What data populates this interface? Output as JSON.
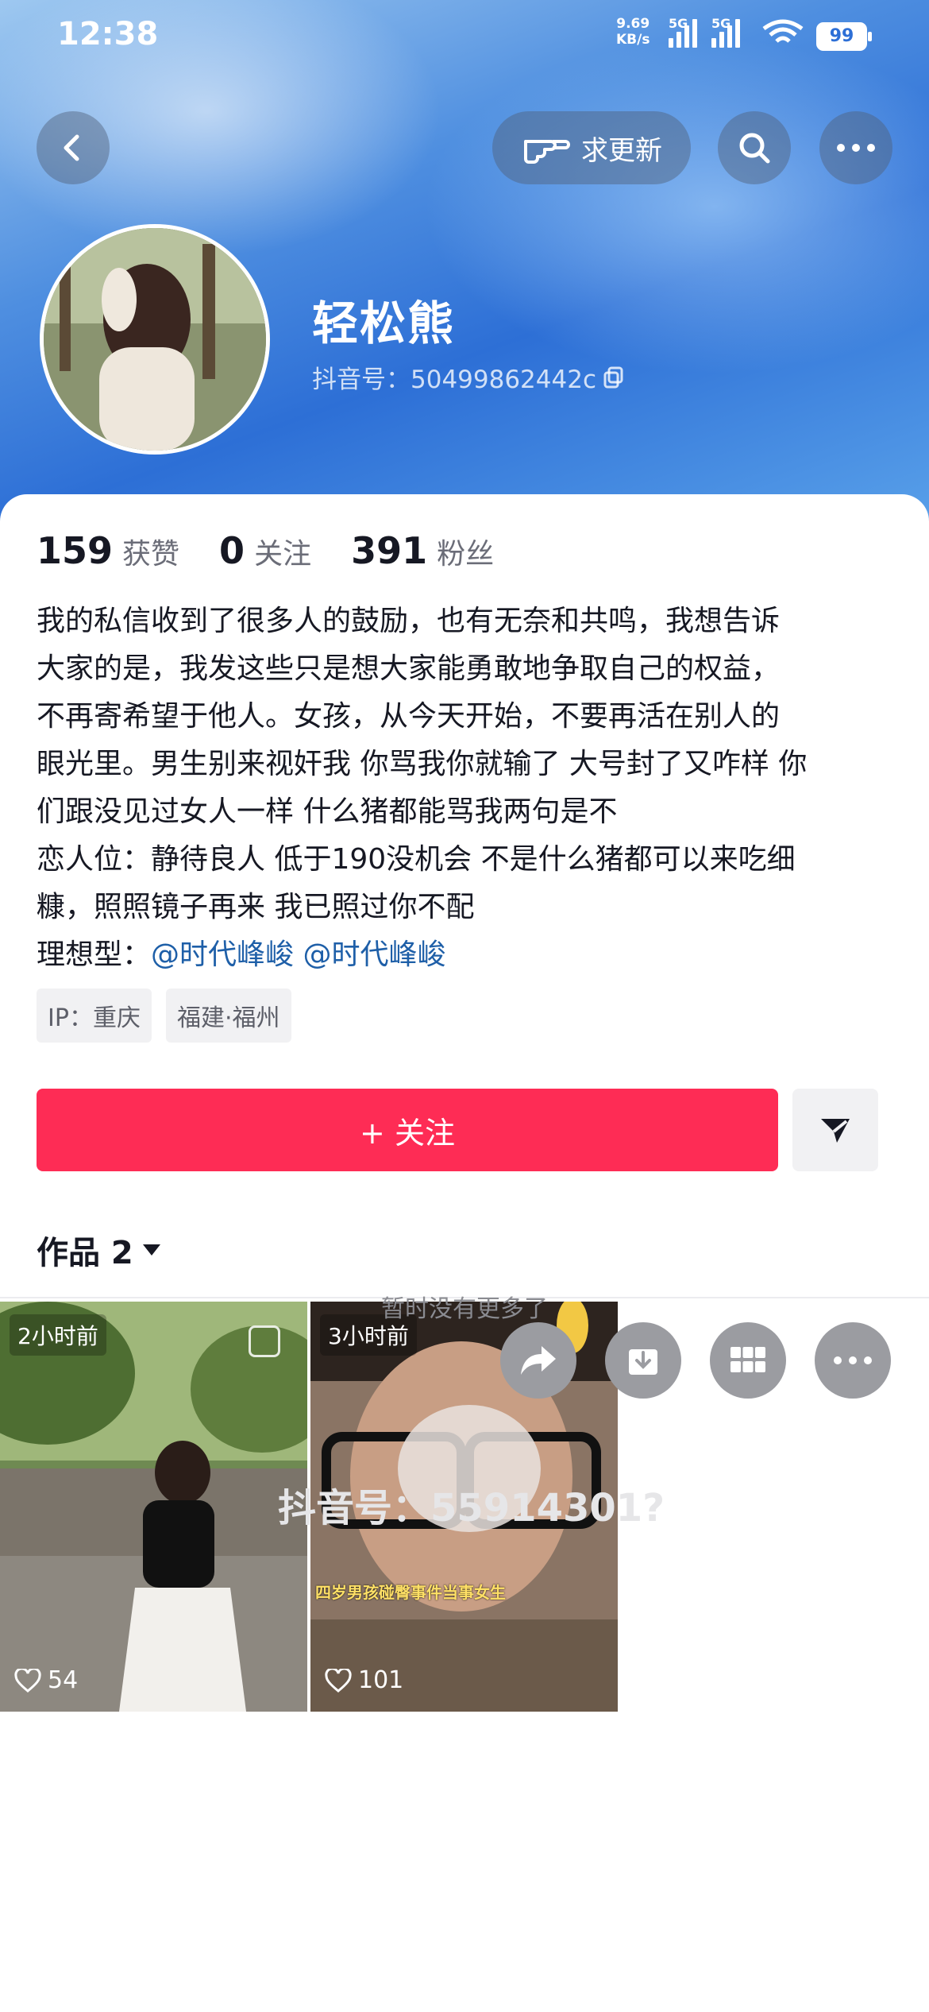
{
  "status_bar": {
    "time": "12:38",
    "speed": "9.69",
    "speed_unit": "KB/s",
    "signal1": "5G",
    "signal2": "5G",
    "battery": "99"
  },
  "header": {
    "request_update_label": "求更新",
    "back_icon": "chevron-left-icon",
    "search_icon": "search-icon",
    "more_icon": "more-icon"
  },
  "profile": {
    "name": "轻松熊",
    "douyin_id": "抖音号：50499862442c"
  },
  "stats": {
    "likes_count": "159",
    "likes_label": "获赞",
    "following_count": "0",
    "following_label": "关注",
    "followers_count": "391",
    "followers_label": "粉丝"
  },
  "bio": {
    "line1": "我的私信收到了很多人的鼓励，也有无奈和共鸣，我想告诉",
    "line2": "大家的是，我发这些只是想大家能勇敢地争取自己的权益，",
    "line3": "不再寄希望于他人。女孩，从今天开始，不要再活在别人的",
    "line4": "眼光里。男生别来视奸我 你骂我你就输了 大号封了又咋样 你",
    "line5": "们跟没见过女人一样 什么猪都能骂我两句是不",
    "line6": "恋人位：静待良人 低于190没机会 不是什么猪都可以来吃细",
    "line7": "糠，照照镜子再来 我已照过你不配",
    "ideal_prefix": "理想型：",
    "mention1": "@时代峰峻",
    "mention2": "@时代峰峻"
  },
  "tags": [
    "IP：重庆",
    "福建·福州"
  ],
  "actions": {
    "follow_label": "+ 关注"
  },
  "works": {
    "tab_label": "作品 2",
    "items": [
      {
        "time": "2小时前",
        "likes": "54"
      },
      {
        "time": "3小时前",
        "likes": "101",
        "caption": "四岁男孩碰臀事件当事女生"
      }
    ]
  },
  "footer": {
    "no_more": "暂时没有更多了",
    "watermark": "抖音号：55914301?"
  },
  "colors": {
    "accent": "#fe2c55",
    "mention": "#1e5fa8",
    "hero_blue": "#2d6fd6"
  }
}
